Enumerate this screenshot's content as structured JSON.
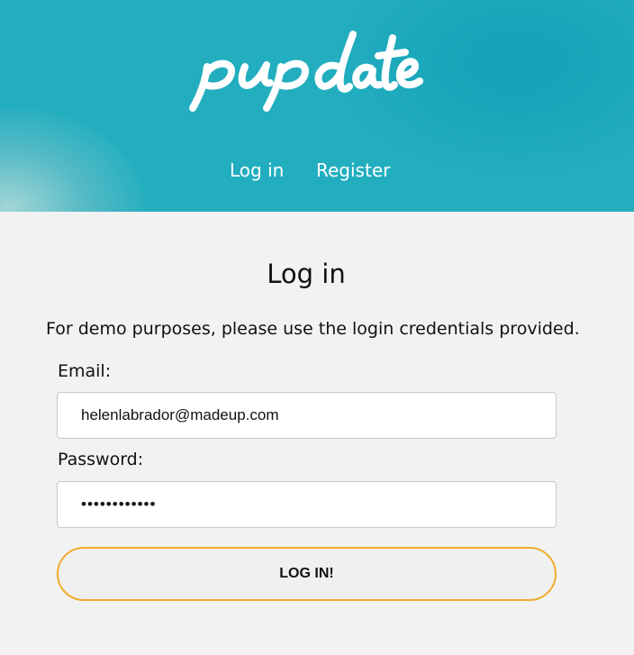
{
  "brand": {
    "logo_text": "pupdate"
  },
  "nav": {
    "login_label": "Log in",
    "register_label": "Register"
  },
  "login_form": {
    "title": "Log in",
    "note": "For demo purposes, please use the login credentials provided.",
    "email_label": "Email:",
    "email_value": "helenlabrador@madeup.com",
    "password_label": "Password:",
    "password_value": "••••••••••••",
    "submit_label": "LOG IN!"
  },
  "colors": {
    "header_bg": "#22aebf",
    "page_bg": "#f2f2f2",
    "button_border": "#efac2e"
  }
}
